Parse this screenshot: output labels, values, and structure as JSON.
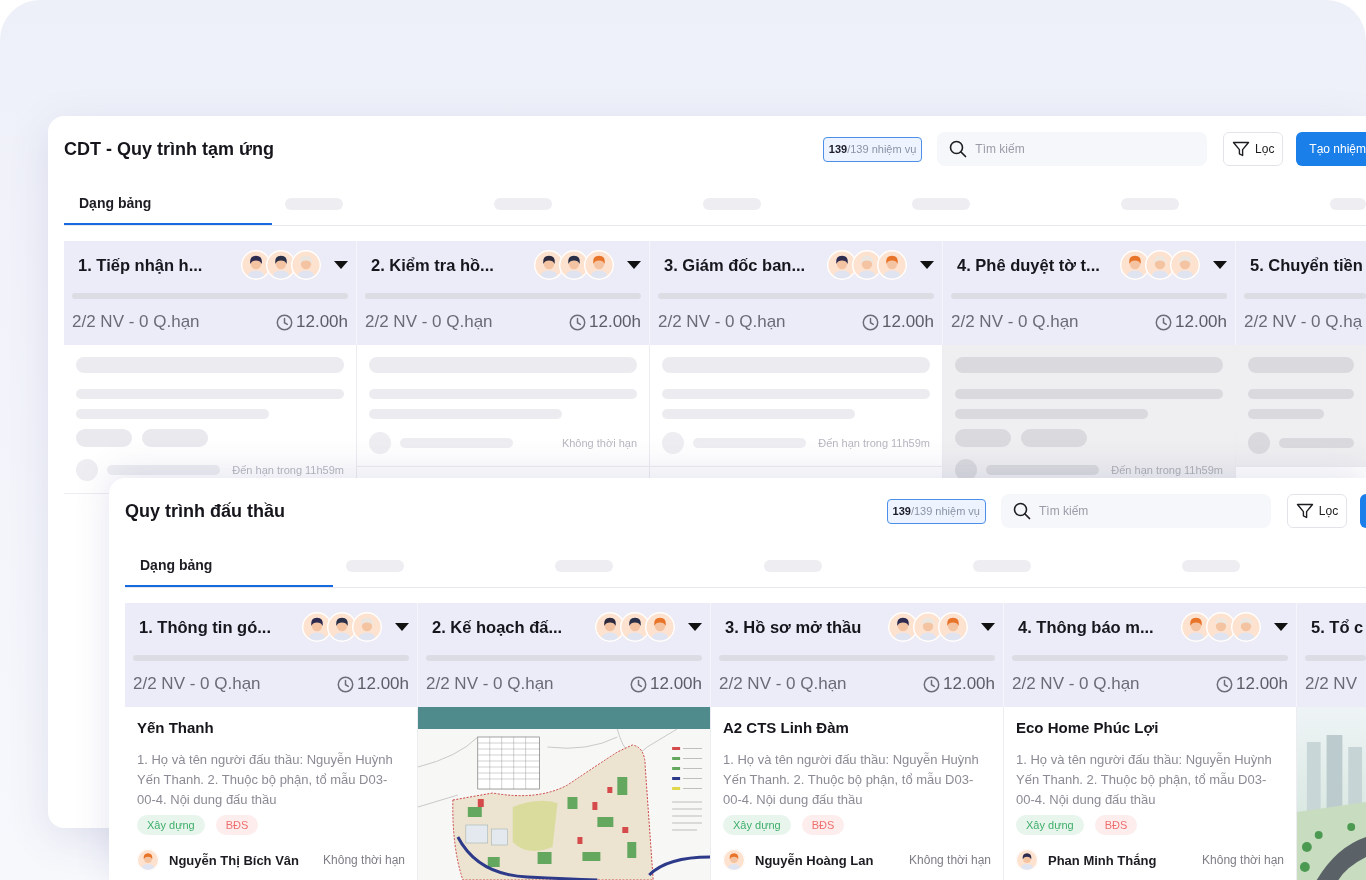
{
  "windows": [
    {
      "title": "CDT - Quy trình tạm ứng",
      "task_count": "**139**/139 nhiệm vụ",
      "search": {
        "placeholder": "Tìm kiếm"
      },
      "filter_button": {
        "label": "Lọc"
      },
      "create_button": {
        "label": "Tạo nhiệm",
        "visible": true
      },
      "tabs": [
        {
          "kind": "text",
          "label": "Dạng bảng",
          "selected": true
        },
        {
          "kind": "placeholder",
          "selected": false
        },
        {
          "kind": "placeholder",
          "selected": false
        },
        {
          "kind": "placeholder",
          "selected": false
        },
        {
          "kind": "placeholder",
          "selected": false
        },
        {
          "kind": "placeholder",
          "selected": false
        },
        {
          "kind": "placeholder",
          "selected": false
        }
      ],
      "columns": [
        {
          "title": "1. Tiếp nhận h...",
          "avatars": [
            {
              "color": "#2d2b4f"
            },
            {
              "color": "#2a3048"
            },
            {
              "color": "#ebe5e0"
            }
          ],
          "dropdown": true,
          "level": 0,
          "stats": "2/2 NV - 0 Q.hạn",
          "duration": "12.00h",
          "cards": [
            {
              "kind": "loading",
              "tag_placeholders": true,
              "dimmed": false,
              "due": "Đến hạn trong 11h59m"
            }
          ]
        },
        {
          "title": "2. Kiểm tra hồ...",
          "avatars": [
            {
              "color": "#2e2b3f"
            },
            {
              "color": "#2a3048"
            },
            {
              "color": "#e8742a"
            }
          ],
          "dropdown": true,
          "level": 0,
          "stats": "2/2 NV - 0 Q.hạn",
          "duration": "12.00h",
          "cards": [
            {
              "kind": "loading",
              "tag_placeholders": false,
              "dimmed": false,
              "due": "Không thời hạn"
            }
          ]
        },
        {
          "title": "3. Giám đốc ban...",
          "avatars": [
            {
              "color": "#2d2b4f"
            },
            {
              "color": "#ece6e1"
            },
            {
              "color": "#e8742a"
            }
          ],
          "dropdown": true,
          "level": 0,
          "stats": "2/2 NV - 0 Q.hạn",
          "duration": "12.00h",
          "cards": [
            {
              "kind": "loading",
              "tag_placeholders": false,
              "dimmed": false,
              "due": "Đến hạn trong 11h59m"
            }
          ]
        },
        {
          "title": "4. Phê duyệt tờ t...",
          "avatars": [
            {
              "color": "#e8742a"
            },
            {
              "color": "#efe6dd"
            },
            {
              "color": "#ece6e1"
            }
          ],
          "dropdown": true,
          "level": 0,
          "stats": "2/2 NV - 0 Q.hạn",
          "duration": "12.00h",
          "cards": [
            {
              "kind": "loading",
              "tag_placeholders": true,
              "dimmed": true,
              "due": "Đến hạn trong 11h59m"
            }
          ]
        },
        {
          "title": "5. Chuyển tiền",
          "level": 0,
          "stats": "2/2 NV - 0 Q.hạ",
          "cards": [
            {
              "kind": "loading",
              "tag_placeholders": false,
              "dimmed": true
            }
          ]
        }
      ]
    },
    {
      "title": "Quy trình đấu thầu",
      "task_count": "**139**/139 nhiệm vụ",
      "search": {
        "placeholder": "Tìm kiếm"
      },
      "filter_button": {
        "label": "Lọc"
      },
      "create_button": {
        "visible": true
      },
      "tabs": [
        {
          "kind": "text",
          "label": "Dạng bảng",
          "selected": true
        },
        {
          "kind": "placeholder",
          "selected": false
        },
        {
          "kind": "placeholder",
          "selected": false
        },
        {
          "kind": "placeholder",
          "selected": false
        },
        {
          "kind": "placeholder",
          "selected": false
        },
        {
          "kind": "placeholder",
          "selected": false
        }
      ],
      "columns": [
        {
          "title": "1. Thông tin gó...",
          "avatars": [
            {
              "color": "#2d2b4f"
            },
            {
              "color": "#2a3048"
            },
            {
              "color": "#ebe5e0"
            }
          ],
          "dropdown": true,
          "level": 0,
          "stats": "2/2 NV - 0 Q.hạn",
          "duration": "12.00h",
          "cards": [
            {
              "kind": "task",
              "title": "Yến Thanh",
              "description": "1. Họ và tên người đấu thầu: Nguyễn Huỳnh Yến Thanh. 2. Thuộc bộ phận, tổ mẫu D03-00-4. Nội dung đấu thầu",
              "tags": [
                {
                  "label": "Xây dựng",
                  "color": "#3fae6a"
                },
                {
                  "label": "BĐS",
                  "color": "#ee6f6f"
                }
              ],
              "avatar": {
                "color": "#e8742a"
              },
              "assignee": "Nguyễn Thị Bích Vân",
              "due": "Không thời hạn"
            }
          ]
        },
        {
          "title": "2. Kế hoạch đấ...",
          "avatars": [
            {
              "color": "#2e2b3f"
            },
            {
              "color": "#2a3048"
            },
            {
              "color": "#e8742a"
            }
          ],
          "dropdown": true,
          "level": 0,
          "stats": "2/2 NV - 0 Q.hạn",
          "duration": "12.00h",
          "cards": [
            {
              "kind": "site_plan"
            }
          ]
        },
        {
          "title": "3. Hồ sơ mở thầu",
          "avatars": [
            {
              "color": "#2d2b4f"
            },
            {
              "color": "#ece6e1"
            },
            {
              "color": "#e8742a"
            }
          ],
          "dropdown": true,
          "level": 0,
          "stats": "2/2 NV - 0 Q.hạn",
          "duration": "12.00h",
          "cards": [
            {
              "kind": "task",
              "title": "A2 CTS Linh Đàm",
              "description": "1. Họ và tên người đấu thầu: Nguyễn Huỳnh Yến Thanh. 2. Thuộc bộ phận, tổ mẫu D03-00-4. Nội dung đấu thầu",
              "tags": [
                {
                  "label": "Xây dựng",
                  "color": "#3fae6a"
                },
                {
                  "label": "BĐS",
                  "color": "#ee6f6f"
                }
              ],
              "avatar": {
                "color": "#e8742a"
              },
              "assignee": "Nguyễn Hoàng Lan",
              "due": "Không thời hạn"
            }
          ]
        },
        {
          "title": "4. Thông báo m...",
          "avatars": [
            {
              "color": "#e8742a"
            },
            {
              "color": "#efe6dd"
            },
            {
              "color": "#ece6e1"
            }
          ],
          "dropdown": true,
          "level": 0,
          "stats": "2/2 NV - 0 Q.hạn",
          "duration": "12.00h",
          "cards": [
            {
              "kind": "task",
              "title": "Eco Home Phúc Lợi",
              "description": "1. Họ và tên người đấu thầu: Nguyễn Huỳnh Yến Thanh. 2. Thuộc bộ phận, tổ mẫu D03-00-4. Nội dung đấu thầu",
              "tags": [
                {
                  "label": "Xây dựng",
                  "color": "#3fae6a"
                },
                {
                  "label": "BĐS",
                  "color": "#ee6f6f"
                }
              ],
              "avatar": {
                "color": "#2d2b4f"
              },
              "assignee": "Phan Minh Thắng",
              "due": "Không thời hạn"
            }
          ]
        },
        {
          "title": "5. Tổ c",
          "level": 0,
          "stats": "2/2 NV",
          "cards": [
            {
              "kind": "building_photo"
            }
          ]
        }
      ]
    }
  ]
}
